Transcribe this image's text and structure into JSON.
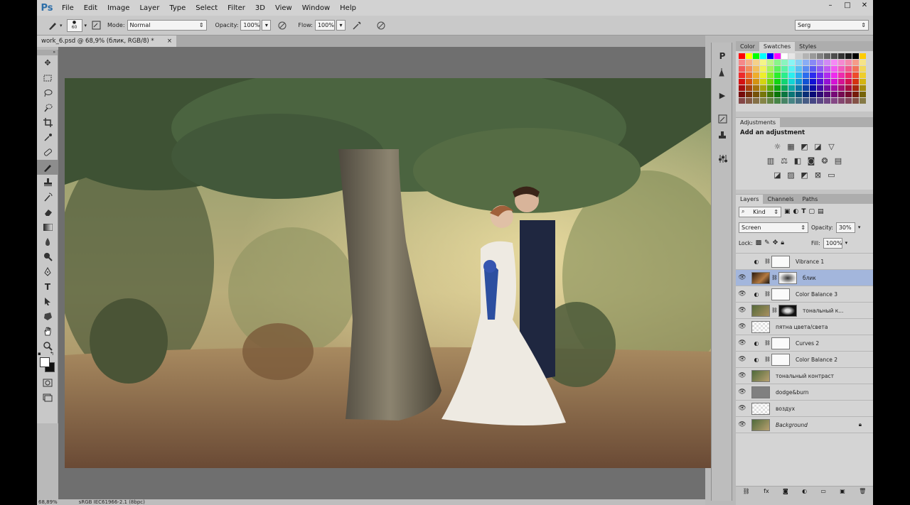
{
  "app": {
    "logo": "Ps",
    "menu": [
      "File",
      "Edit",
      "Image",
      "Layer",
      "Type",
      "Select",
      "Filter",
      "3D",
      "View",
      "Window",
      "Help"
    ],
    "window_controls": [
      "–",
      "□",
      "✕"
    ]
  },
  "options_bar": {
    "brush_size": "60",
    "mode_label": "Mode:",
    "mode_value": "Normal",
    "opacity_label": "Opacity:",
    "opacity_value": "100%",
    "flow_label": "Flow:",
    "flow_value": "100%",
    "workspace": "Serg"
  },
  "document": {
    "tab_title": "work_6.psd @ 68,9% (блик, RGB/8) *",
    "tab_close": "×"
  },
  "status_bar": {
    "zoom": "68,89%",
    "profile": "sRGB IEC61966-2.1 (8bpc)"
  },
  "color_panel": {
    "tabs": [
      "Color",
      "Swatches",
      "Styles"
    ],
    "active_tab": "Swatches"
  },
  "adjustments_panel": {
    "tab": "Adjustments",
    "title": "Add an adjustment"
  },
  "layers_panel": {
    "tabs": [
      "Layers",
      "Channels",
      "Paths"
    ],
    "kind_label": "Kind",
    "blend_mode": "Screen",
    "opacity_label": "Opacity:",
    "opacity_value": "30%",
    "lock_label": "Lock:",
    "fill_label": "Fill:",
    "fill_value": "100%",
    "layers": [
      {
        "name": "Vibrance 1",
        "visible": false,
        "type": "adjustment",
        "selected": false
      },
      {
        "name": "блик",
        "visible": true,
        "type": "image-mask",
        "selected": true
      },
      {
        "name": "Color Balance 3",
        "visible": true,
        "type": "adjustment",
        "selected": false
      },
      {
        "name": "тональный к...",
        "visible": true,
        "type": "image-mask-dark",
        "selected": false
      },
      {
        "name": "пятна цвета/света",
        "visible": true,
        "type": "transparent",
        "selected": false
      },
      {
        "name": "Curves 2",
        "visible": true,
        "type": "adjustment",
        "selected": false
      },
      {
        "name": "Color Balance 2",
        "visible": true,
        "type": "adjustment",
        "selected": false
      },
      {
        "name": "тональный контраст",
        "visible": true,
        "type": "image",
        "selected": false
      },
      {
        "name": "dodge&burn",
        "visible": true,
        "type": "gray",
        "selected": false
      },
      {
        "name": "воздух",
        "visible": true,
        "type": "transparent",
        "selected": false
      },
      {
        "name": "Background",
        "visible": true,
        "type": "image",
        "selected": false
      }
    ]
  }
}
